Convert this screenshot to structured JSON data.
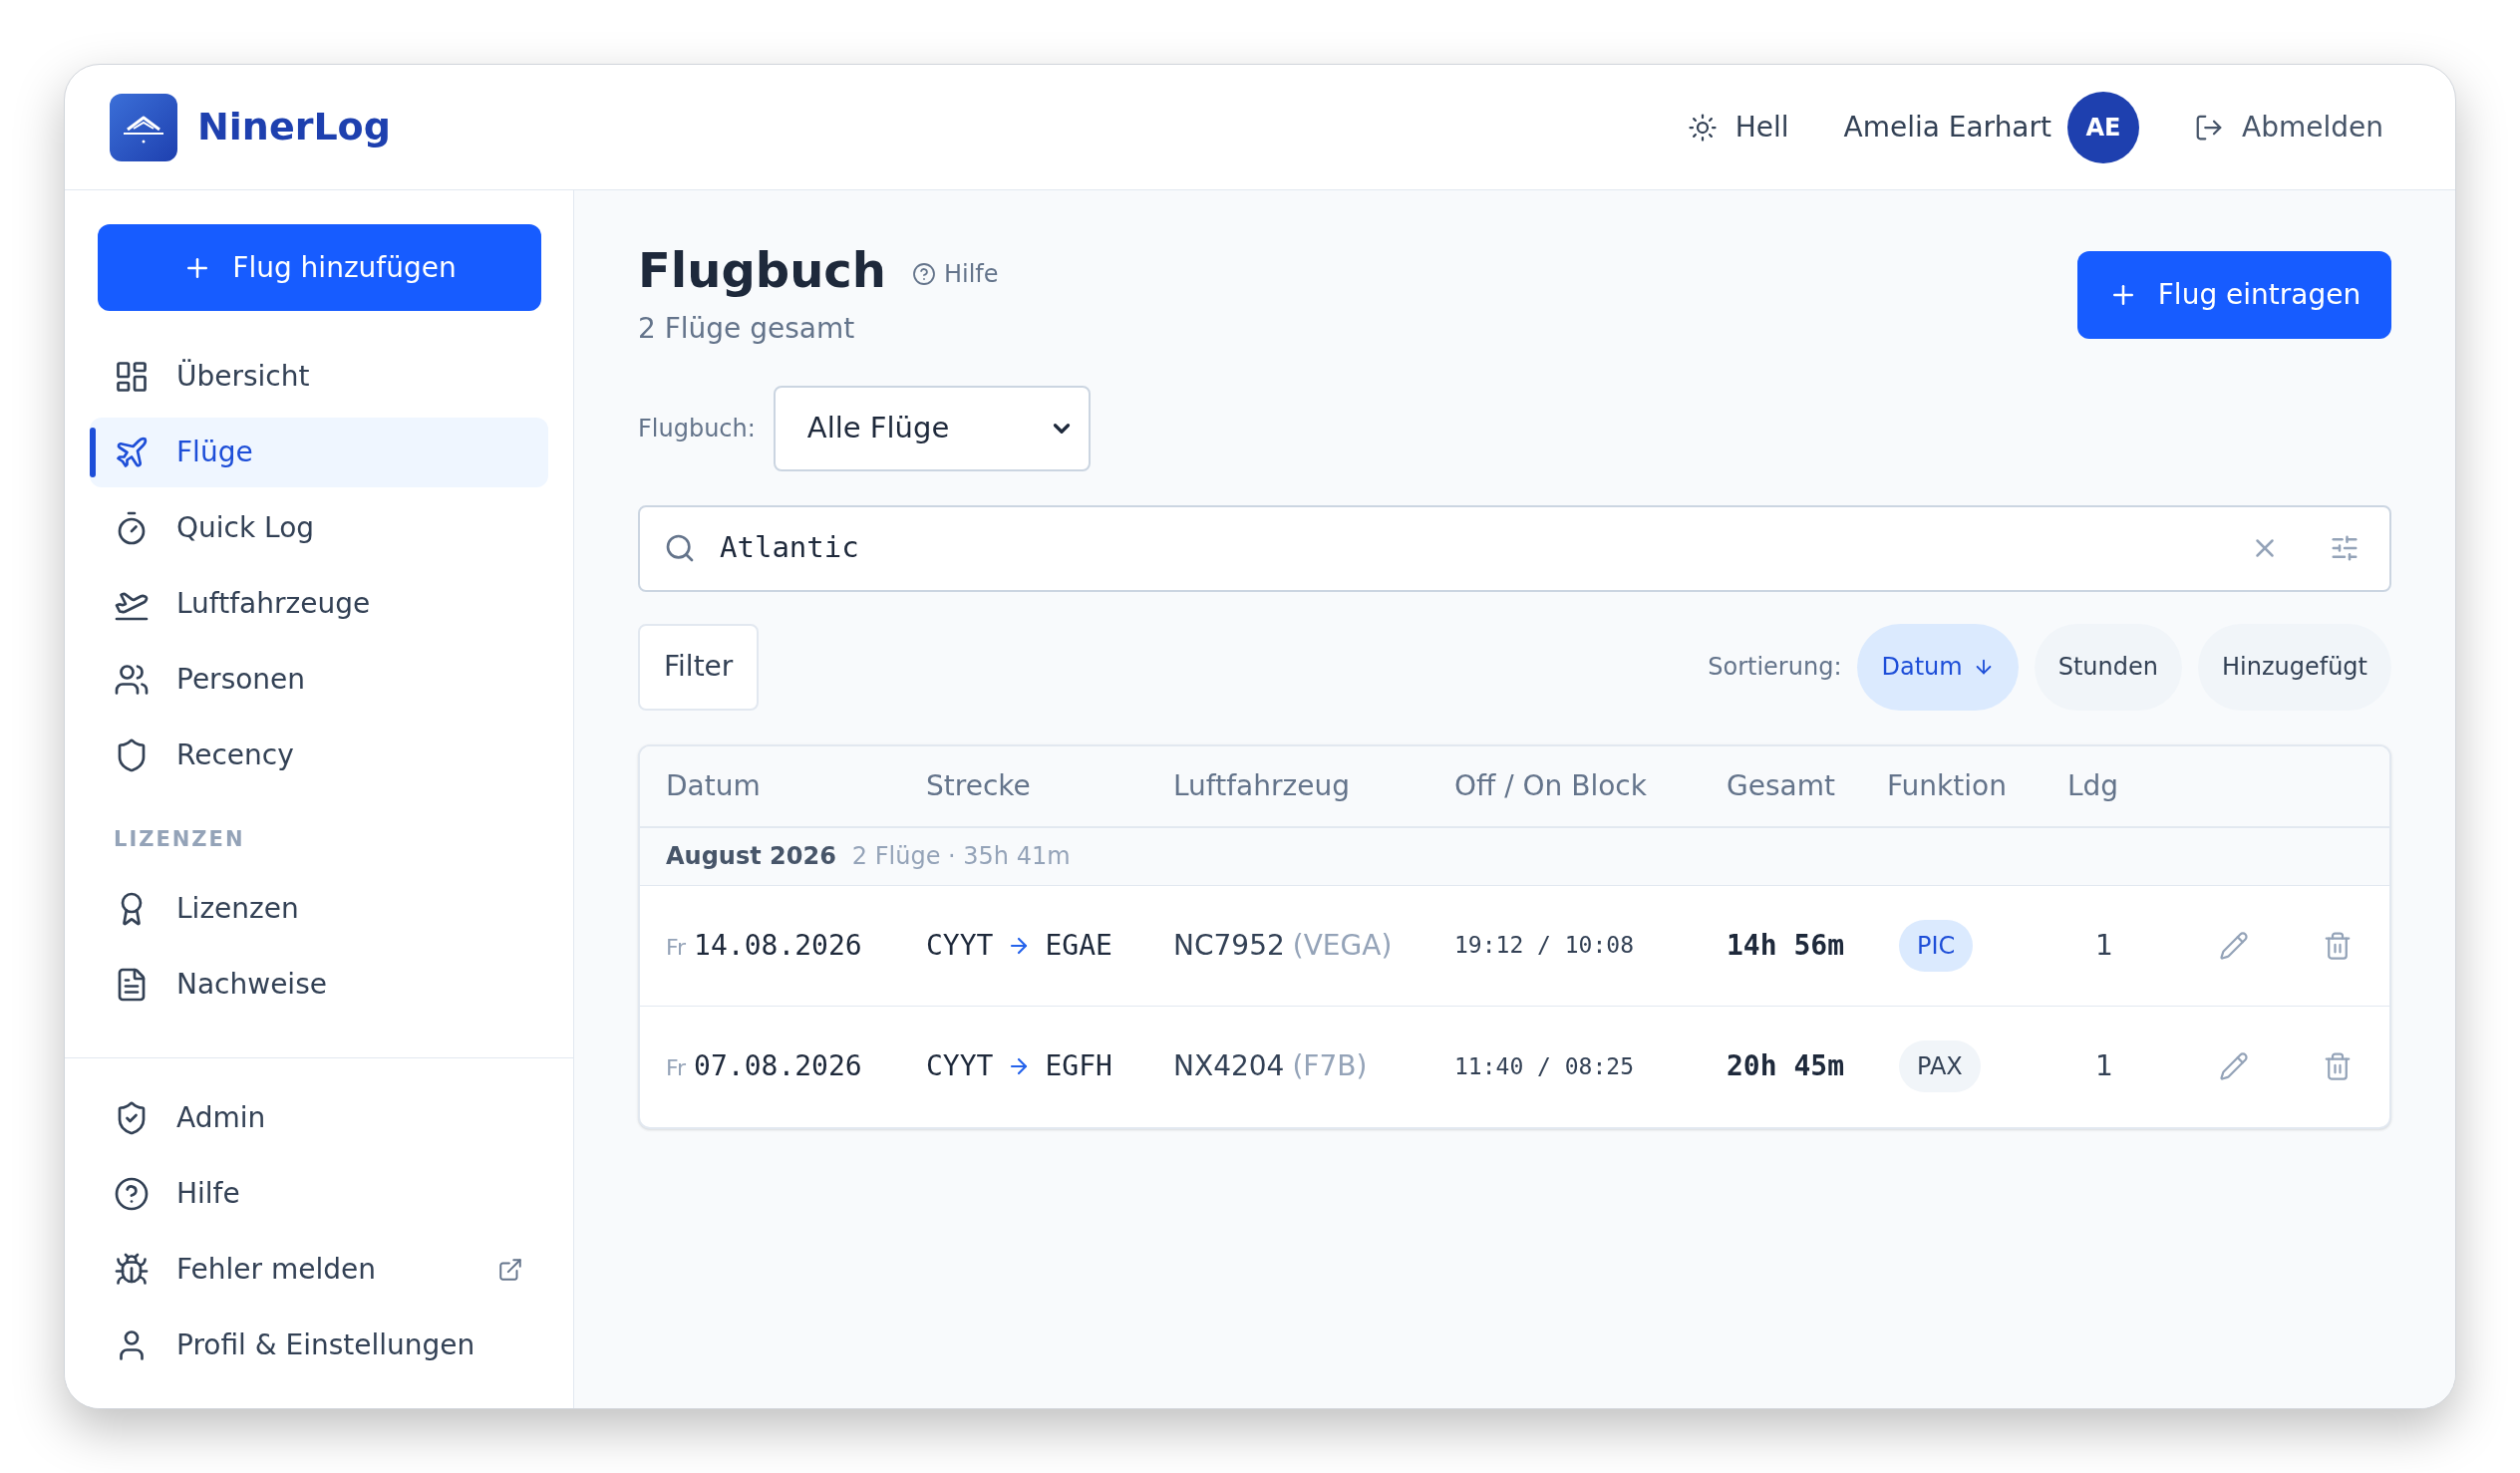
{
  "app": {
    "name": "NinerLog"
  },
  "header": {
    "theme_toggle": "Hell",
    "user_name": "Amelia Earhart",
    "avatar_initials": "AE",
    "logout": "Abmelden"
  },
  "sidebar": {
    "add_button": "Flug hinzufügen",
    "main_items": [
      {
        "label": "Übersicht",
        "selected": false
      },
      {
        "label": "Flüge",
        "selected": true
      },
      {
        "label": "Quick Log",
        "selected": false
      },
      {
        "label": "Luftfahrzeuge",
        "selected": false
      },
      {
        "label": "Personen",
        "selected": false
      },
      {
        "label": "Recency",
        "selected": false
      }
    ],
    "section_label": "LIZENZEN",
    "license_items": [
      {
        "label": "Lizenzen",
        "selected": false
      },
      {
        "label": "Nachweise",
        "selected": false
      }
    ],
    "footer_items": [
      {
        "label": "Admin",
        "external": false
      },
      {
        "label": "Hilfe",
        "external": false
      },
      {
        "label": "Fehler melden",
        "external": true
      },
      {
        "label": "Profil & Einstellungen",
        "external": false
      }
    ]
  },
  "main": {
    "title": "Flugbuch",
    "help_link": "Hilfe",
    "subtitle": "2 Flüge gesamt",
    "primary_button": "Flug eintragen",
    "logbook_select": {
      "label": "Flugbuch:",
      "value": "Alle Flüge"
    },
    "search": {
      "value": "Atlantic"
    },
    "filter_button": "Filter",
    "sort": {
      "label": "Sortierung:",
      "options": [
        {
          "label": "Datum",
          "selected": true
        },
        {
          "label": "Stunden",
          "selected": false
        },
        {
          "label": "Hinzugefügt",
          "selected": false
        }
      ]
    },
    "table": {
      "columns": [
        "Datum",
        "Strecke",
        "Luftfahrzeug",
        "Off / On Block",
        "Gesamt",
        "Funktion",
        "Ldg"
      ],
      "groups": [
        {
          "title": "August 2026",
          "summary": "2 Flüge · 35h 41m",
          "rows": [
            {
              "weekday": "Fr",
              "date": "14.08.2026",
              "from": "CYYT",
              "to": "EGAE",
              "registration": "NC7952",
              "aircraft_type": "(VEGA)",
              "block": "19:12 / 10:08",
              "total": "14h 56m",
              "function": {
                "label": "PIC",
                "highlighted": true
              },
              "landings": "1"
            },
            {
              "weekday": "Fr",
              "date": "07.08.2026",
              "from": "CYYT",
              "to": "EGFH",
              "registration": "NX4204",
              "aircraft_type": "(F7B)",
              "block": "11:40 / 08:25",
              "total": "20h 45m",
              "function": {
                "label": "PAX",
                "highlighted": false
              },
              "landings": "1"
            }
          ]
        }
      ]
    }
  }
}
